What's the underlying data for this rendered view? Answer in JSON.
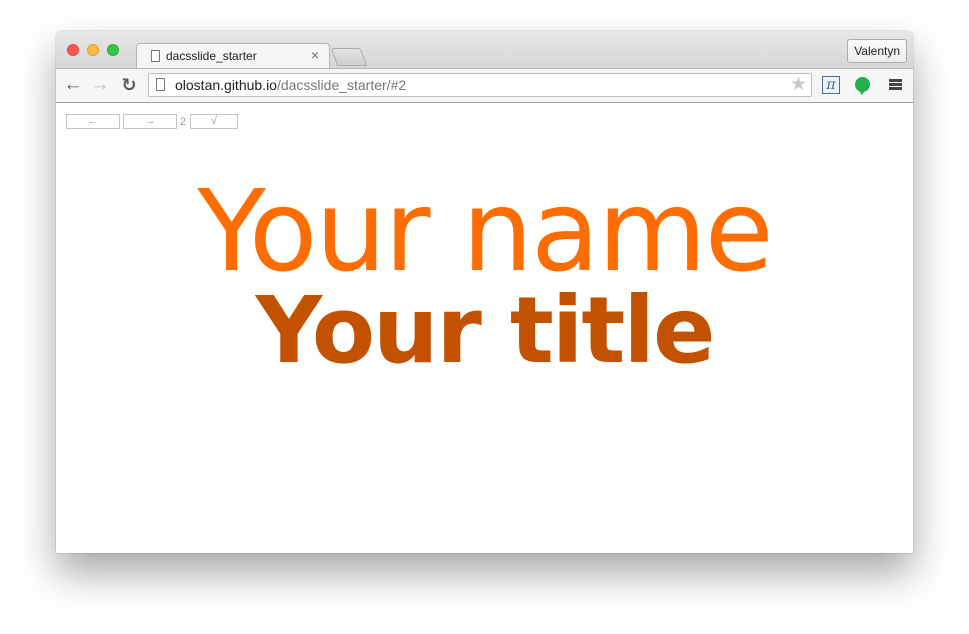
{
  "profile": {
    "name": "Valentyn"
  },
  "tab": {
    "title": "dacsslide_starter",
    "close_glyph": "×"
  },
  "address_bar": {
    "host": "olostan.github.io",
    "path": "/dacsslide_starter/#2"
  },
  "toolbar": {
    "back_glyph": "←",
    "forward_glyph": "→",
    "reload_glyph": "↻",
    "star_glyph": "★",
    "extension_pi_glyph": "π"
  },
  "slide_controls": {
    "prev_label": "←",
    "next_label": "→",
    "slide_number": "2",
    "done_label": "√"
  },
  "slide": {
    "name": "Your name",
    "title": "Your title"
  },
  "colors": {
    "name_color": "#ff6d00",
    "title_color": "#c25100"
  }
}
